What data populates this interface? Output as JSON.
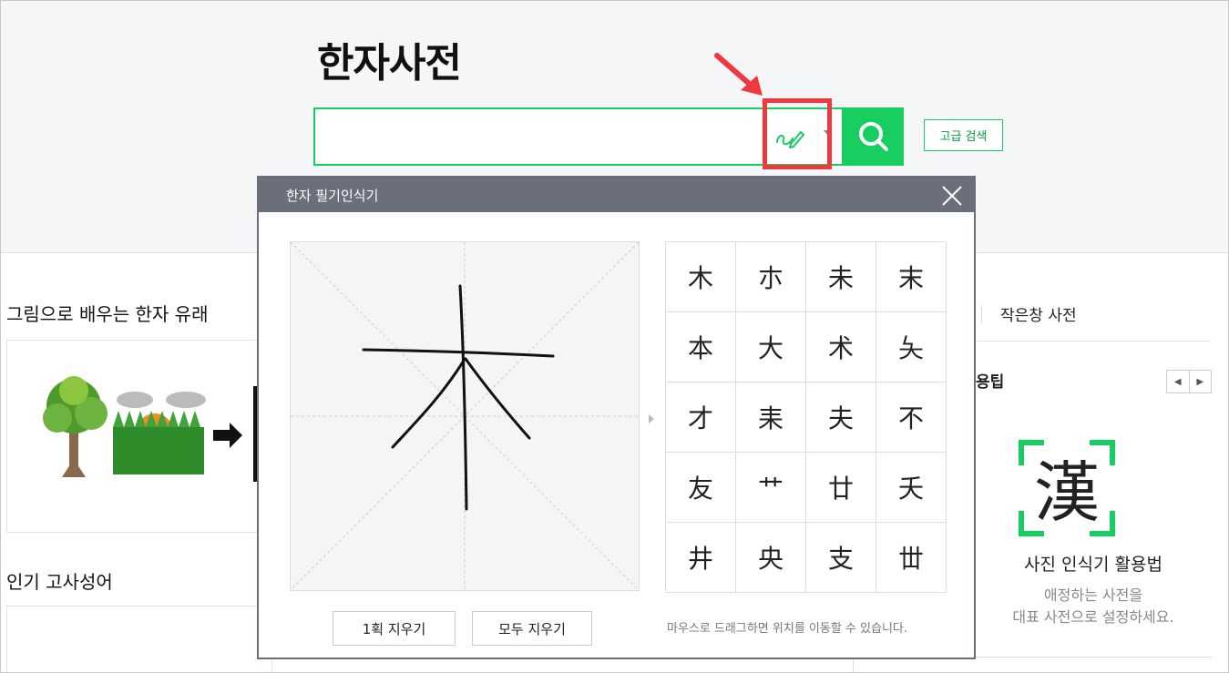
{
  "header": {
    "title": "한자사전",
    "search": {
      "value": "",
      "placeholder": ""
    },
    "advanced_search_label": "고급 검색"
  },
  "left": {
    "section1_title": "그림으로 배우는 한자 유래",
    "section2_title": "인기 고사성어"
  },
  "right": {
    "mini_dict_link": "작은창 사전",
    "tip_title": "용팁",
    "tip_char": "漢",
    "tip_subtitle": "사진 인식기 활용법",
    "tip_desc_line1": "애정하는 사전을",
    "tip_desc_line2": "대표 사전으로 설정하세요."
  },
  "popup": {
    "title": "한자 필기인식기",
    "candidates": [
      "木",
      "朩",
      "未",
      "末",
      "本",
      "大",
      "术",
      "夨",
      "才",
      "耒",
      "夫",
      "不",
      "友",
      "艹",
      "廿",
      "夭",
      "井",
      "央",
      "支",
      "丗"
    ],
    "clear_one_label": "1획 지우기",
    "clear_all_label": "모두 지우기",
    "hint": "마우스로 드래그하면 위치를 이동할 수 있습니다."
  },
  "colors": {
    "accent": "#19ce60",
    "highlight": "#f0393f",
    "popup_header": "#6b6f7c"
  },
  "icons": {
    "handwriting": "pen-curve-icon",
    "search": "search-icon",
    "close": "close-icon"
  }
}
